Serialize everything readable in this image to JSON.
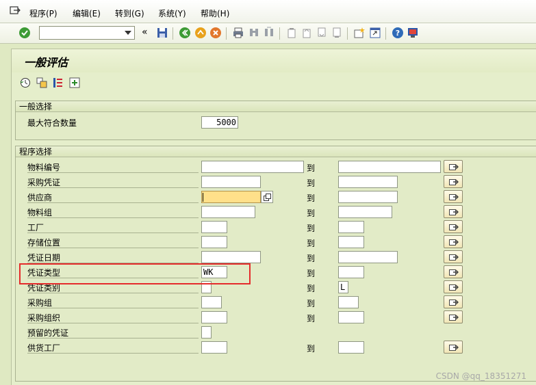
{
  "menu": [
    {
      "label": "程序(P)"
    },
    {
      "label": "编辑(E)"
    },
    {
      "label": "转到(G)"
    },
    {
      "label": "系统(Y)"
    },
    {
      "label": "帮助(H)"
    }
  ],
  "toolbar": {
    "command_field_value": "",
    "back_glyph": "«"
  },
  "page": {
    "title": "一般评估"
  },
  "general_selection": {
    "title": "一般选择",
    "max_hits_label": "最大符合数量",
    "max_hits_value": "5000"
  },
  "program_selection": {
    "title": "程序选择",
    "to_label": "到",
    "rows": [
      {
        "label": "物料编号",
        "from": "",
        "to": ""
      },
      {
        "label": "采购凭证",
        "from": "",
        "to": ""
      },
      {
        "label": "供应商",
        "from": "",
        "to": ""
      },
      {
        "label": "物料组",
        "from": "",
        "to": ""
      },
      {
        "label": "工厂",
        "from": "",
        "to": ""
      },
      {
        "label": "存储位置",
        "from": "",
        "to": ""
      },
      {
        "label": "凭证日期",
        "from": "",
        "to": ""
      },
      {
        "label": "凭证类型",
        "from": "WK",
        "to": ""
      },
      {
        "label": "凭证类别",
        "from": "",
        "to": "L"
      },
      {
        "label": "采购组",
        "from": "",
        "to": ""
      },
      {
        "label": "采购组织",
        "from": "",
        "to": ""
      },
      {
        "label": "预留的凭证",
        "from": ""
      },
      {
        "label": "供货工厂",
        "from": "",
        "to": ""
      }
    ]
  },
  "watermark": "CSDN @qq_18351271",
  "colors": {
    "background": "#dfe9c2",
    "highlight_box": "#e52b2b",
    "focused_field": "#ffe08a"
  }
}
